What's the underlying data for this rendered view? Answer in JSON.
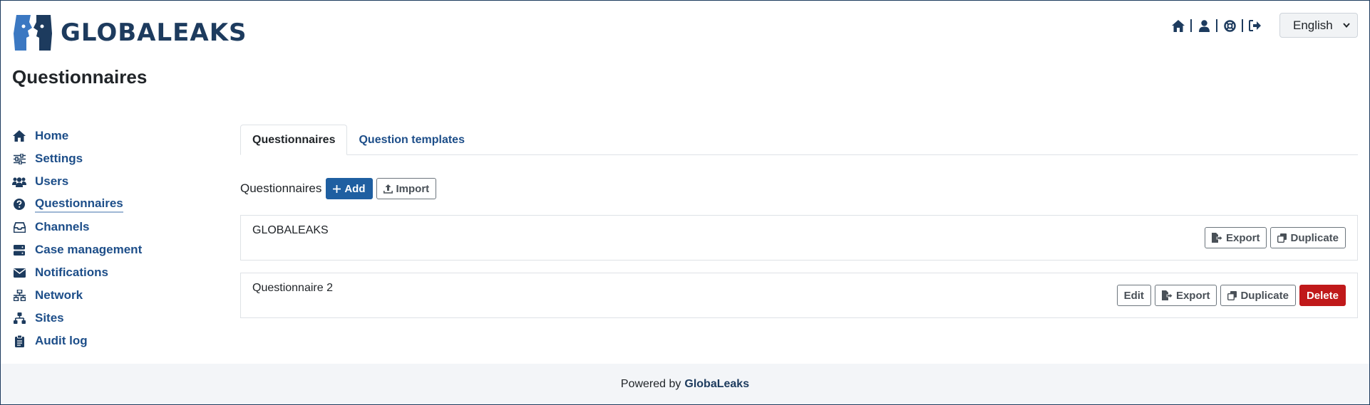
{
  "app": {
    "logo_text": "GLOBALEAKS",
    "colors": {
      "brand": "#1d3b5e",
      "link": "#1d4e89",
      "primary": "#1f5fa1",
      "danger": "#c0191a"
    }
  },
  "topnav": {
    "icons": [
      "home-icon",
      "user-icon",
      "support-icon",
      "logout-icon"
    ]
  },
  "language": {
    "selected": "English"
  },
  "page": {
    "title": "Questionnaires"
  },
  "sidebar": {
    "items": [
      {
        "label": "Home",
        "icon": "home-icon"
      },
      {
        "label": "Settings",
        "icon": "sliders-icon"
      },
      {
        "label": "Users",
        "icon": "users-icon"
      },
      {
        "label": "Questionnaires",
        "icon": "question-circle-icon",
        "active": true
      },
      {
        "label": "Channels",
        "icon": "inbox-icon"
      },
      {
        "label": "Case management",
        "icon": "server-icon"
      },
      {
        "label": "Notifications",
        "icon": "envelope-icon"
      },
      {
        "label": "Network",
        "icon": "network-icon"
      },
      {
        "label": "Sites",
        "icon": "sitemap-icon"
      },
      {
        "label": "Audit log",
        "icon": "clipboard-icon"
      }
    ]
  },
  "tabs": [
    {
      "label": "Questionnaires",
      "active": true
    },
    {
      "label": "Question templates",
      "active": false
    }
  ],
  "toolbar": {
    "label": "Questionnaires",
    "add_label": "Add",
    "import_label": "Import"
  },
  "questionnaires": [
    {
      "name": "GLOBALEAKS",
      "actions": {
        "export": "Export",
        "duplicate": "Duplicate"
      }
    },
    {
      "name": "Questionnaire 2",
      "actions": {
        "edit": "Edit",
        "export": "Export",
        "duplicate": "Duplicate",
        "delete": "Delete"
      }
    }
  ],
  "footer": {
    "prefix": "Powered by",
    "brand": "GlobaLeaks"
  }
}
